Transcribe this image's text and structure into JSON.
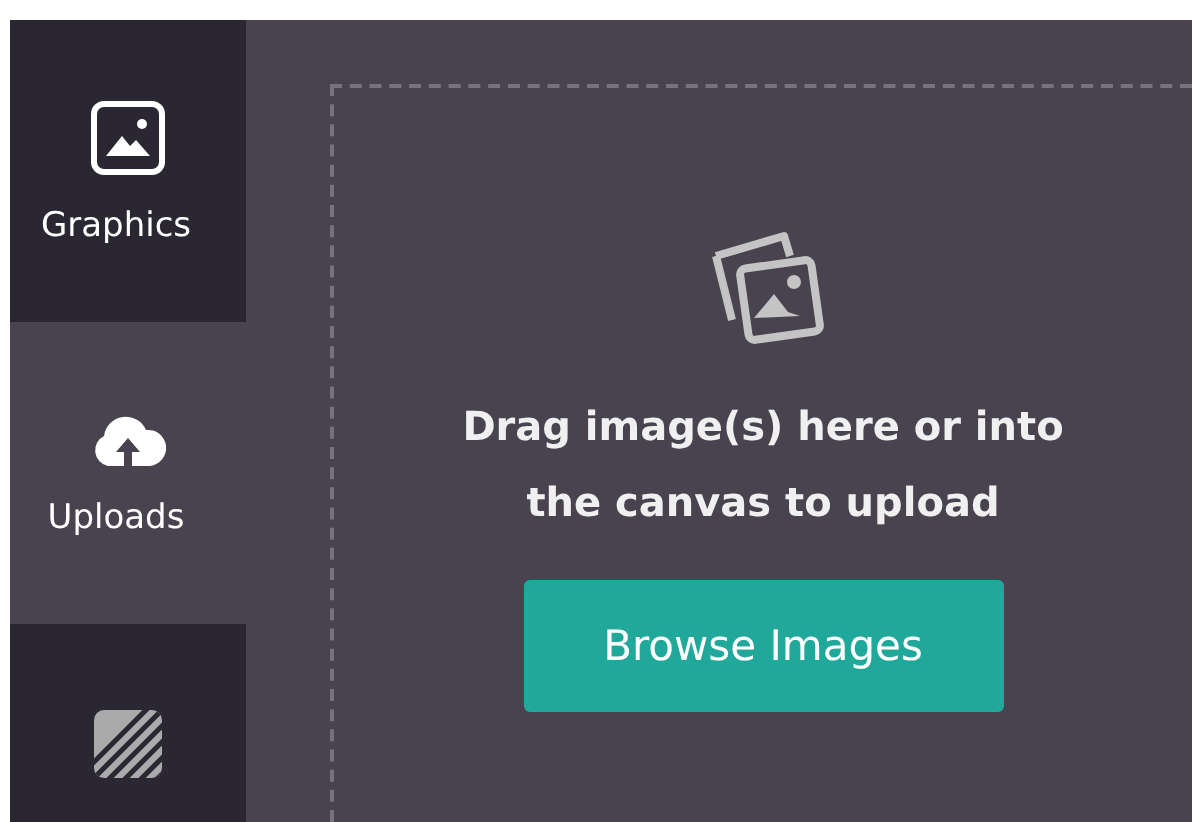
{
  "sidebar": {
    "items": [
      {
        "label": "Graphics",
        "kind": "graphics",
        "selected": false
      },
      {
        "label": "Uploads",
        "kind": "uploads",
        "selected": true
      },
      {
        "kind": "pattern",
        "selected": false
      }
    ]
  },
  "dropzone": {
    "message": "Drag image(s) here or into the canvas to upload",
    "button": "Browse Images"
  }
}
